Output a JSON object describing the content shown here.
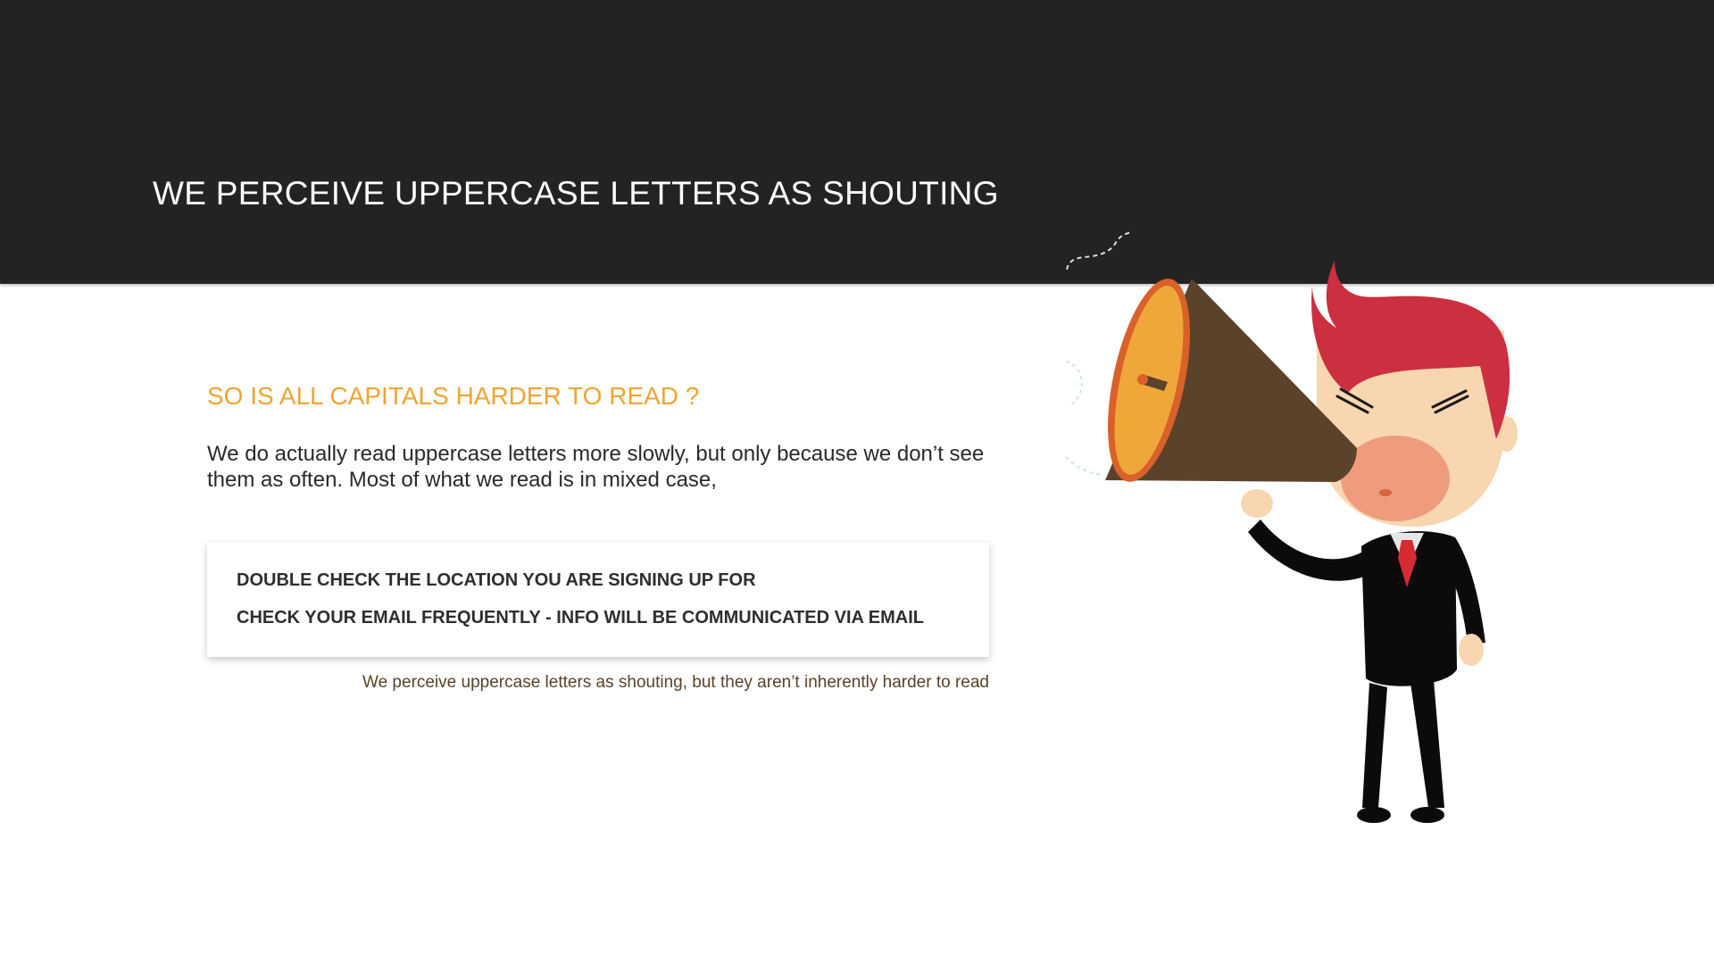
{
  "header": {
    "title": "WE PERCEIVE UPPERCASE LETTERS AS SHOUTING"
  },
  "content": {
    "subheading": "SO IS ALL CAPITALS HARDER TO READ ?",
    "paragraph": "We do actually read uppercase letters more slowly, but only because we don’t see them as often. Most of what we read is in mixed case,",
    "card": {
      "lines": [
        "DOUBLE CHECK THE LOCATION YOU ARE SIGNING UP FOR",
        "CHECK YOUR EMAIL FREQUENTLY - INFO WILL BE COMMUNICATED VIA EMAIL"
      ]
    },
    "caption": "We perceive uppercase letters as shouting, but they aren’t inherently harder to read"
  },
  "illustration": {
    "subject": "man-shouting-into-megaphone",
    "colors": {
      "hair": "#cc2f40",
      "skin": "#f7d6b0",
      "suit": "#0d0b0a",
      "tie": "#d62b35",
      "megaphone_body": "#5b432b",
      "megaphone_rim": "#d9612a",
      "megaphone_inner": "#efa73a",
      "mouth": "#ee9c7d"
    }
  },
  "colors": {
    "header_bg": "#232323",
    "accent": "#efa530",
    "caption": "#5a4228"
  }
}
